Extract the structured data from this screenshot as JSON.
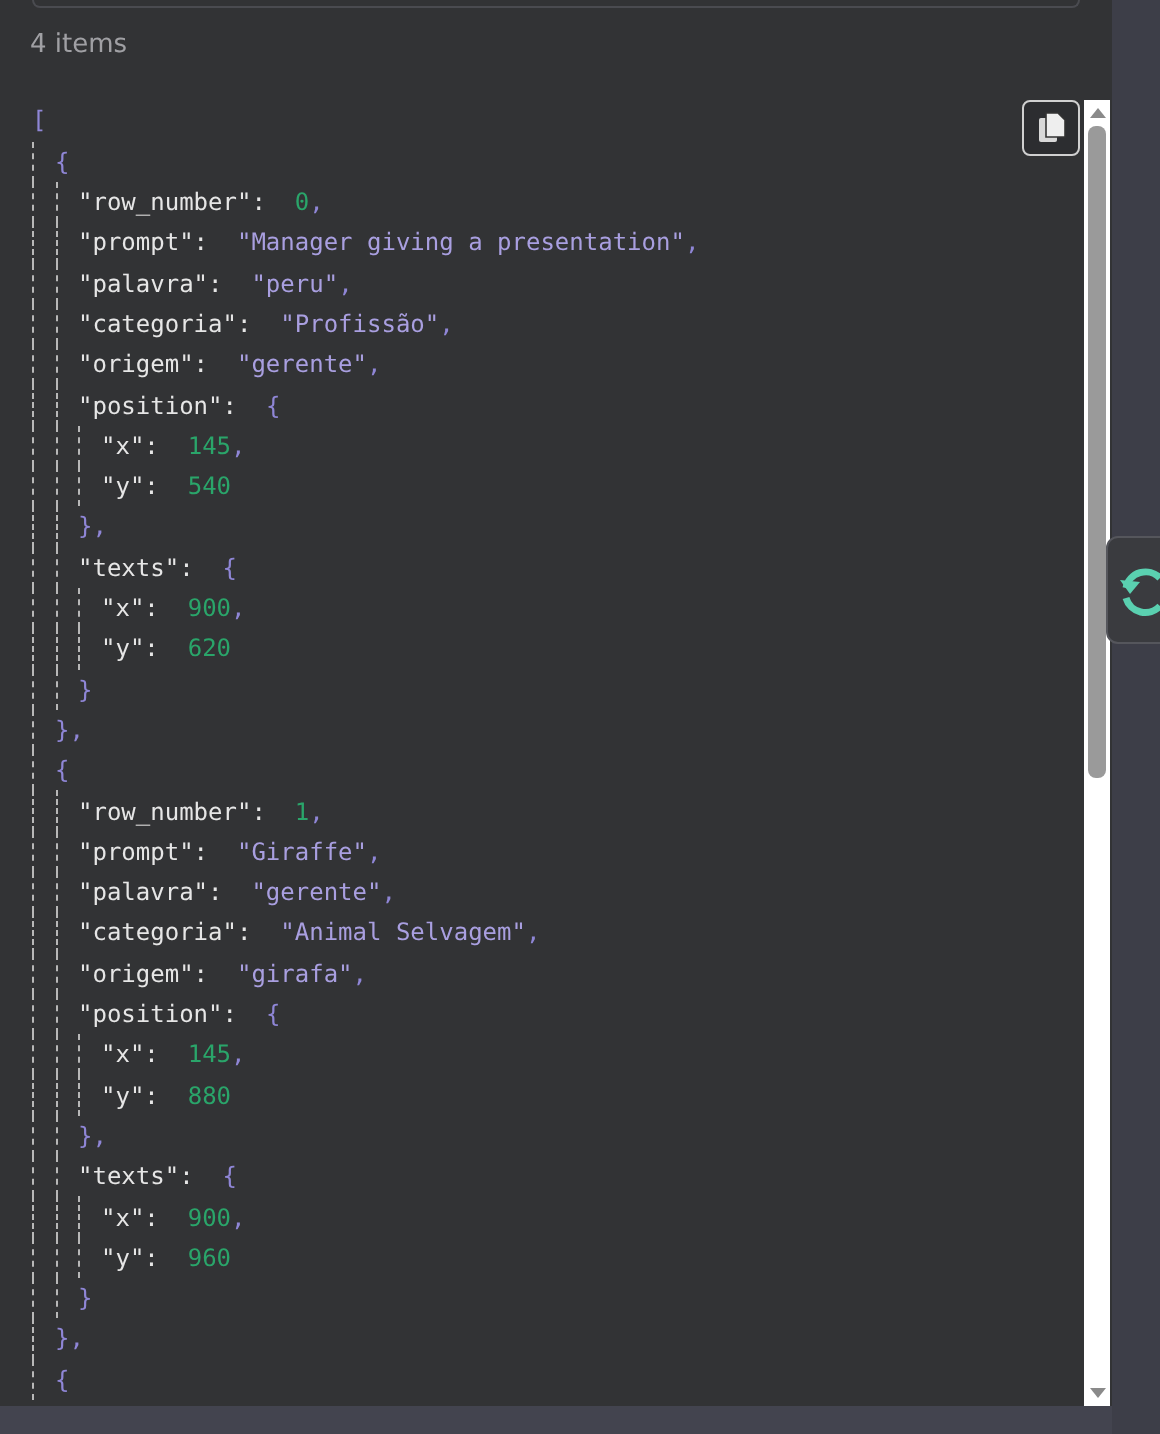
{
  "item_count": "4 items",
  "json_view": {
    "open": "[",
    "children": [
      {
        "open": "{",
        "close": "},",
        "children": [
          {
            "kind": "number",
            "key": "\"row_number\":",
            "value": "0",
            "sep": ","
          },
          {
            "kind": "string",
            "key": "\"prompt\":",
            "value": "\"Manager giving a presentation\"",
            "sep": ","
          },
          {
            "kind": "string",
            "key": "\"palavra\":",
            "value": "\"peru\"",
            "sep": ","
          },
          {
            "kind": "string",
            "key": "\"categoria\":",
            "value": "\"Profissão\"",
            "sep": ","
          },
          {
            "kind": "string",
            "key": "\"origem\":",
            "value": "\"gerente\"",
            "sep": ","
          },
          {
            "kind": "object",
            "key": "\"position\":",
            "open": "{",
            "close": "},",
            "children": [
              {
                "kind": "number",
                "key": "\"x\":",
                "value": "145",
                "sep": ","
              },
              {
                "kind": "number",
                "key": "\"y\":",
                "value": "540"
              }
            ]
          },
          {
            "kind": "object",
            "key": "\"texts\":",
            "open": "{",
            "close": "}",
            "children": [
              {
                "kind": "number",
                "key": "\"x\":",
                "value": "900",
                "sep": ","
              },
              {
                "kind": "number",
                "key": "\"y\":",
                "value": "620"
              }
            ]
          }
        ]
      },
      {
        "open": "{",
        "close": "},",
        "children": [
          {
            "kind": "number",
            "key": "\"row_number\":",
            "value": "1",
            "sep": ","
          },
          {
            "kind": "string",
            "key": "\"prompt\":",
            "value": "\"Giraffe\"",
            "sep": ","
          },
          {
            "kind": "string",
            "key": "\"palavra\":",
            "value": "\"gerente\"",
            "sep": ","
          },
          {
            "kind": "string",
            "key": "\"categoria\":",
            "value": "\"Animal Selvagem\"",
            "sep": ","
          },
          {
            "kind": "string",
            "key": "\"origem\":",
            "value": "\"girafa\"",
            "sep": ","
          },
          {
            "kind": "object",
            "key": "\"position\":",
            "open": "{",
            "close": "},",
            "children": [
              {
                "kind": "number",
                "key": "\"x\":",
                "value": "145",
                "sep": ","
              },
              {
                "kind": "number",
                "key": "\"y\":",
                "value": "880"
              }
            ]
          },
          {
            "kind": "object",
            "key": "\"texts\":",
            "open": "{",
            "close": "}",
            "children": [
              {
                "kind": "number",
                "key": "\"x\":",
                "value": "900",
                "sep": ","
              },
              {
                "kind": "number",
                "key": "\"y\":",
                "value": "960"
              }
            ]
          }
        ]
      },
      {
        "open": "{"
      }
    ]
  }
}
